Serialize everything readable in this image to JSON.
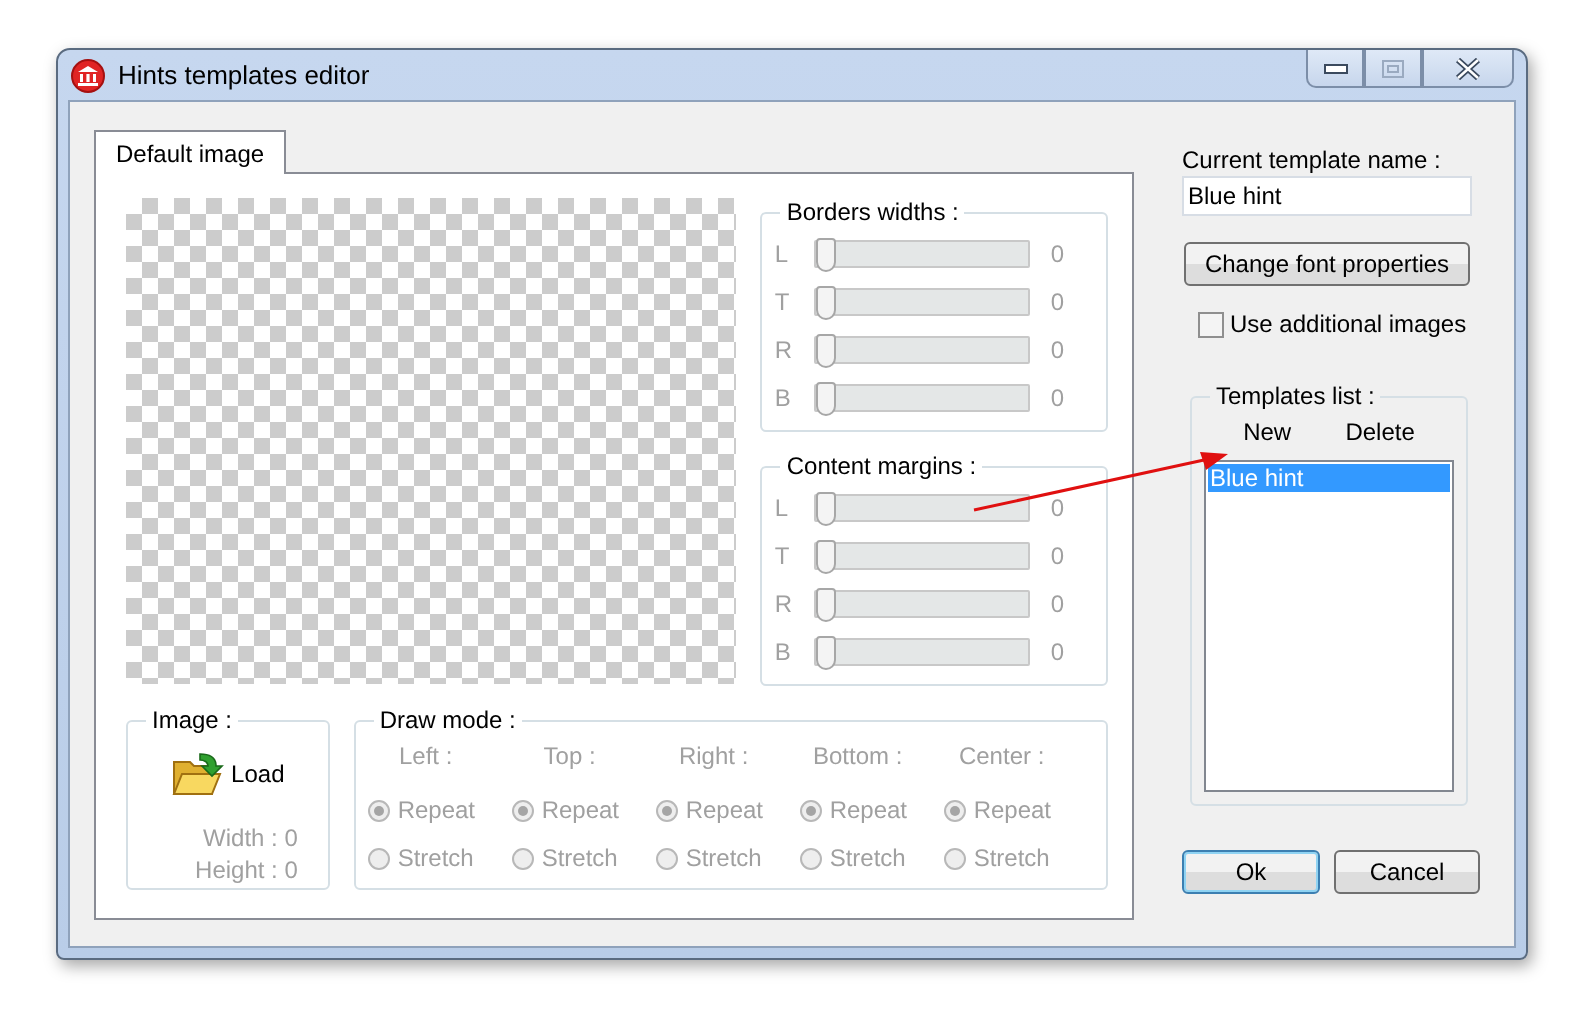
{
  "window": {
    "title": "Hints templates editor"
  },
  "tabs": [
    {
      "label": "Default image",
      "selected": true
    }
  ],
  "slider_groups": [
    {
      "title": "Borders widths :",
      "disabled": true,
      "rows": [
        {
          "label": "L",
          "level": 0,
          "value": "0"
        },
        {
          "label": "T",
          "level": 0,
          "value": "0"
        },
        {
          "label": "R",
          "level": 0,
          "value": "0"
        },
        {
          "label": "B",
          "level": 0,
          "value": "0"
        }
      ]
    },
    {
      "title": "Content margins :",
      "disabled": true,
      "rows": [
        {
          "label": "L",
          "level": 0,
          "value": "0"
        },
        {
          "label": "T",
          "level": 0,
          "value": "0"
        },
        {
          "label": "R",
          "level": 0,
          "value": "0"
        },
        {
          "label": "B",
          "level": 0,
          "value": "0"
        }
      ]
    }
  ],
  "image": {
    "title": "Image :",
    "load": "Load",
    "width": "Width :  0",
    "height": "Height :  0",
    "disabled": true
  },
  "draw_mode": {
    "title": "Draw mode :",
    "disabled": true,
    "columns": [
      {
        "header": "Left :",
        "options": [
          {
            "label": "Repeat",
            "selected": true
          },
          {
            "label": "Stretch",
            "selected": false
          }
        ]
      },
      {
        "header": "Top :",
        "options": [
          {
            "label": "Repeat",
            "selected": true
          },
          {
            "label": "Stretch",
            "selected": false
          }
        ]
      },
      {
        "header": "Right :",
        "options": [
          {
            "label": "Repeat",
            "selected": true
          },
          {
            "label": "Stretch",
            "selected": false
          }
        ]
      },
      {
        "header": "Bottom :",
        "options": [
          {
            "label": "Repeat",
            "selected": true
          },
          {
            "label": "Stretch",
            "selected": false
          }
        ]
      },
      {
        "header": "Center :",
        "options": [
          {
            "label": "Repeat",
            "selected": true
          },
          {
            "label": "Stretch",
            "selected": false
          }
        ]
      }
    ]
  },
  "current_template": {
    "label": "Current template name :",
    "value": "Blue hint"
  },
  "font_button": "Change font properties",
  "additional_images": {
    "label": "Use additional images",
    "checked": false
  },
  "templates_list": {
    "title": "Templates list :",
    "actions": [
      "New",
      "Delete"
    ],
    "items": [
      {
        "label": "Blue hint",
        "selected": true
      }
    ]
  },
  "dialog_buttons": [
    {
      "label": "Ok",
      "default": true
    },
    {
      "label": "Cancel",
      "default": false
    }
  ]
}
